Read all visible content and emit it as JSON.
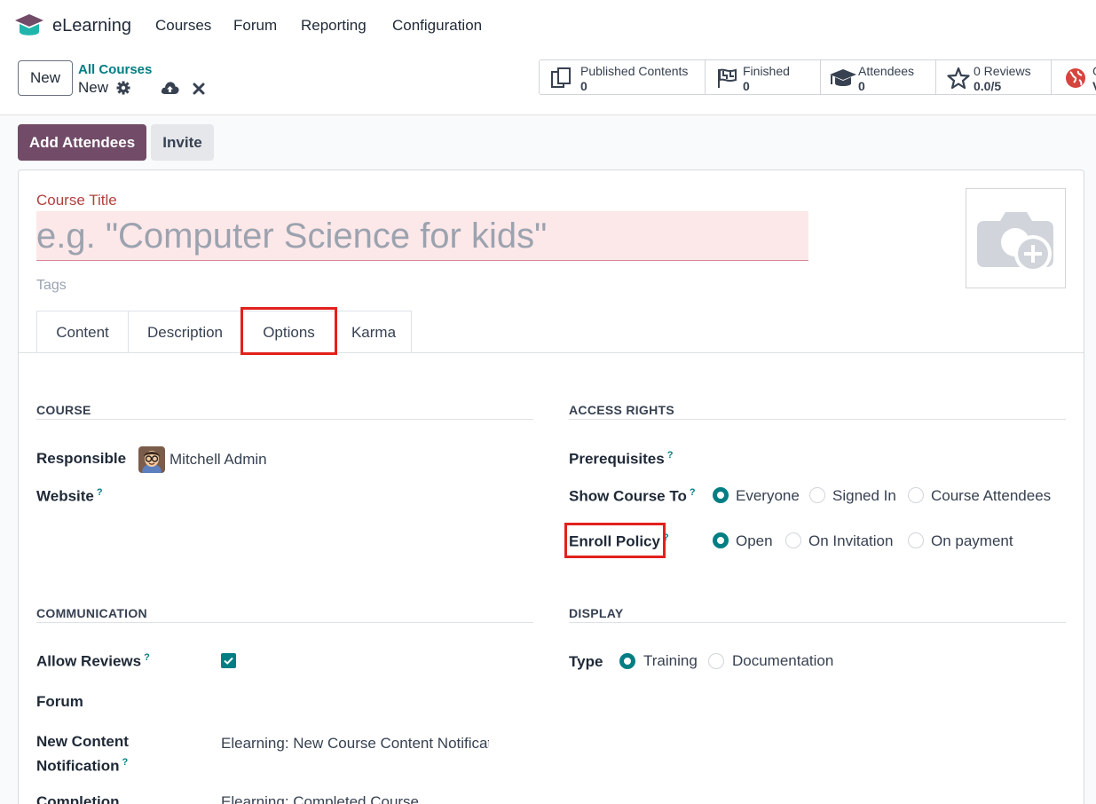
{
  "app": {
    "name": "eLearning",
    "menu": [
      "Courses",
      "Forum",
      "Reporting",
      "Configuration"
    ]
  },
  "control_panel": {
    "new_button": "New",
    "breadcrumb_parent": "All Courses",
    "breadcrumb_current": "New"
  },
  "stats": [
    {
      "label": "Published Contents",
      "value": "0",
      "icon": "documents-icon"
    },
    {
      "label": "Finished",
      "value": "0",
      "icon": "flag-icon"
    },
    {
      "label": "Attendees",
      "value": "0",
      "icon": "graduation-cap-icon"
    },
    {
      "label": "0 Reviews",
      "value": "0.0/5",
      "icon": "star-icon"
    },
    {
      "label": "G",
      "value": "V",
      "icon": "globe-icon"
    }
  ],
  "status_buttons": {
    "add_attendees": "Add Attendees",
    "invite": "Invite"
  },
  "form": {
    "title_label": "Course Title",
    "title_placeholder": "e.g. \"Computer Science for kids\"",
    "tags_placeholder": "Tags",
    "tabs": [
      "Content",
      "Description",
      "Options",
      "Karma"
    ],
    "active_tab": "Options"
  },
  "course": {
    "section": "COURSE",
    "responsible_label": "Responsible",
    "responsible_value": "Mitchell Admin",
    "website_label": "Website"
  },
  "access_rights": {
    "section": "ACCESS RIGHTS",
    "prerequisites_label": "Prerequisites",
    "show_course_label": "Show Course To",
    "show_course_options": [
      "Everyone",
      "Signed In",
      "Course Attendees"
    ],
    "show_course_selected": "Everyone",
    "enroll_policy_label": "Enroll Policy",
    "enroll_policy_options": [
      "Open",
      "On Invitation",
      "On payment"
    ],
    "enroll_policy_selected": "Open"
  },
  "communication": {
    "section": "COMMUNICATION",
    "allow_reviews_label": "Allow Reviews",
    "allow_reviews_checked": true,
    "forum_label": "Forum",
    "new_content_label_line1": "New Content",
    "new_content_label_line2": "Notification",
    "new_content_value": "Elearning: New Course Content Notification",
    "completion_label": "Completion",
    "completion_value": "Elearning: Completed Course"
  },
  "display": {
    "section": "DISPLAY",
    "type_label": "Type",
    "type_options": [
      "Training",
      "Documentation"
    ],
    "type_selected": "Training"
  },
  "help_mark": "?",
  "colors": {
    "primary": "#714b67",
    "accent": "#017e84",
    "highlight": "#e2211c",
    "required_bg": "#fde8e9"
  }
}
